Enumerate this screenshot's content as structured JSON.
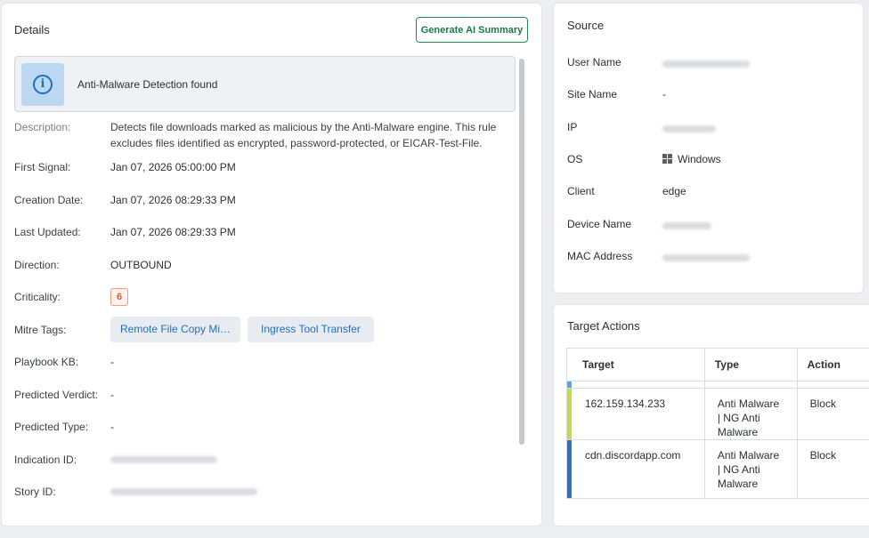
{
  "details": {
    "title": "Details",
    "generate_button": "Generate AI Summary",
    "banner_text": "Anti-Malware Detection found",
    "fields": {
      "description_label": "Description:",
      "description_value": "Detects file downloads marked as malicious by the Anti-Malware engine. This rule excludes files identified as encrypted, password-protected, or EICAR-Test-File.",
      "first_signal_label": "First Signal:",
      "first_signal_value": "Jan 07, 2026 05:00:00 PM",
      "creation_date_label": "Creation Date:",
      "creation_date_value": "Jan 07, 2026 08:29:33 PM",
      "last_updated_label": "Last Updated:",
      "last_updated_value": "Jan 07, 2026 08:29:33 PM",
      "direction_label": "Direction:",
      "direction_value": "OUTBOUND",
      "criticality_label": "Criticality:",
      "criticality_value": "6",
      "mitre_label": "Mitre Tags:",
      "mitre_tags": [
        "Remote File Copy Mi…",
        "Ingress Tool Transfer"
      ],
      "playbook_label": "Playbook KB:",
      "playbook_value": "-",
      "predicted_verdict_label": "Predicted Verdict:",
      "predicted_verdict_value": "-",
      "predicted_type_label": "Predicted Type:",
      "predicted_type_value": "-",
      "indication_id_label": "Indication ID:",
      "story_id_label": "Story ID:"
    }
  },
  "source": {
    "title": "Source",
    "user_name_label": "User Name",
    "site_name_label": "Site Name",
    "site_name_value": "-",
    "ip_label": "IP",
    "os_label": "OS",
    "os_value": "Windows",
    "client_label": "Client",
    "client_value": "edge",
    "device_name_label": "Device Name",
    "mac_label": "MAC Address"
  },
  "target_actions": {
    "title": "Target Actions",
    "columns": [
      "Target",
      "Type",
      "Action"
    ],
    "rows": [
      {
        "target": "162.159.134.233",
        "type_lines": [
          "Anti Malware",
          "| NG Anti",
          "Malware"
        ],
        "action": "Block",
        "bar_color": "#c5d94a"
      },
      {
        "target": "cdn.discordapp.com",
        "type_lines": [
          "Anti Malware",
          "| NG Anti",
          "Malware"
        ],
        "action": "Block",
        "bar_color": "#2f6fd1"
      }
    ]
  },
  "colors": {
    "accent_green": "#1f8f57",
    "direction_purple": "#9b2ca8",
    "criticality_orange": "#e25a33",
    "link_blue": "#1d6fc4",
    "top_bar_blue": "#5aa4e0"
  },
  "icons": [
    "info-icon",
    "windows-icon"
  ]
}
